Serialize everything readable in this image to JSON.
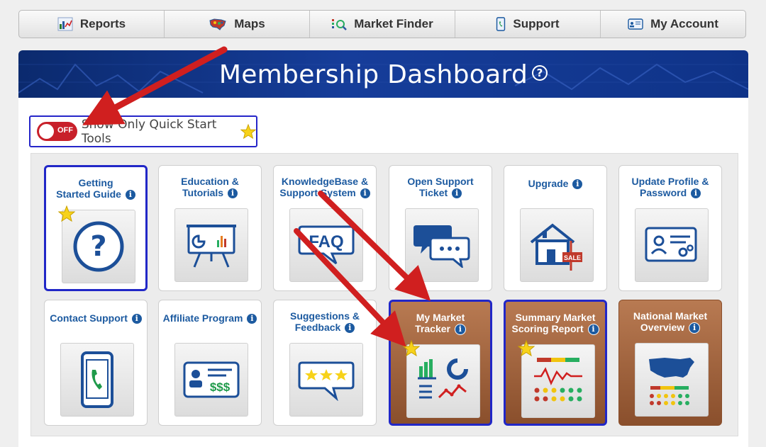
{
  "nav": [
    {
      "label": "Reports",
      "icon": "reports-icon"
    },
    {
      "label": "Maps",
      "icon": "usa-map-icon"
    },
    {
      "label": "Market Finder",
      "icon": "market-finder-icon"
    },
    {
      "label": "Support",
      "icon": "phone-icon"
    },
    {
      "label": "My Account",
      "icon": "id-card-icon"
    }
  ],
  "banner": {
    "title": "Membership Dashboard",
    "help": "?"
  },
  "toggle": {
    "state": "OFF",
    "label": "Show Only Quick Start Tools"
  },
  "tiles": [
    {
      "title1": "Getting",
      "title2": "Started Guide",
      "info": "i",
      "icon": "question-icon"
    },
    {
      "title1": "Education &",
      "title2": "Tutorials",
      "info": "i",
      "icon": "presentation-board-icon"
    },
    {
      "title1": "KnowledgeBase &",
      "title2": "Support System",
      "info": "i",
      "icon": "faq-bubble-icon"
    },
    {
      "title1": "Open Support",
      "title2": "Ticket",
      "info": "i",
      "icon": "chat-bubbles-icon"
    },
    {
      "title1": "Upgrade",
      "title2": "",
      "info": "i",
      "icon": "house-sale-icon"
    },
    {
      "title1": "Update Profile &",
      "title2": "Password",
      "info": "i",
      "icon": "profile-card-gear-icon"
    },
    {
      "title1": "Contact Support",
      "title2": "",
      "info": "i",
      "icon": "smartphone-icon"
    },
    {
      "title1": "Affiliate Program",
      "title2": "",
      "info": "i",
      "icon": "id-dollar-icon"
    },
    {
      "title1": "Suggestions &",
      "title2": "Feedback",
      "info": "i",
      "icon": "stars-bubble-icon"
    },
    {
      "title1": "My Market",
      "title2": "Tracker",
      "info": "i",
      "icon": "market-charts-icon"
    },
    {
      "title1": "Summary Market",
      "title2": "Scoring Report",
      "info": "i",
      "icon": "scoring-report-icon"
    },
    {
      "title1": "National Market",
      "title2": "Overview",
      "info": "i",
      "icon": "national-map-icon"
    }
  ],
  "colors": {
    "accent": "#1c5aa0",
    "banner": "#163d9a",
    "toggle_off": "#c8202a",
    "selected_border": "#2127c7",
    "arrow": "#d01f1f",
    "star": "#f7d21a"
  }
}
